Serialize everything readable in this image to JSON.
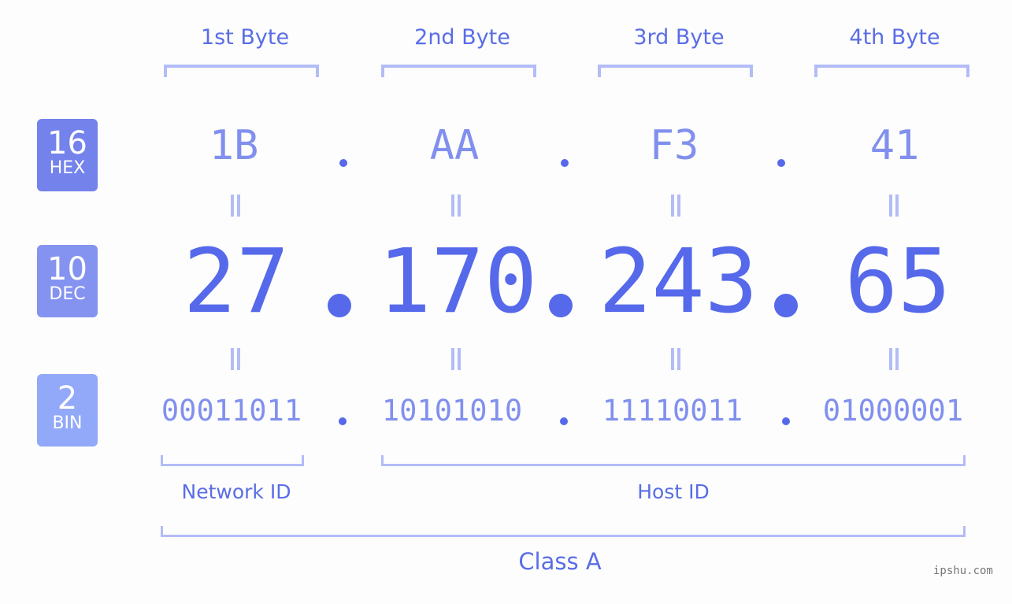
{
  "bytes": [
    {
      "label": "1st Byte",
      "hex": "1B",
      "dec": "27",
      "bin": "00011011"
    },
    {
      "label": "2nd Byte",
      "hex": "AA",
      "dec": "170",
      "bin": "10101010"
    },
    {
      "label": "3rd Byte",
      "hex": "F3",
      "dec": "243",
      "bin": "11110011"
    },
    {
      "label": "4th Byte",
      "hex": "41",
      "dec": "65",
      "bin": "01000001"
    }
  ],
  "badges": {
    "hex": {
      "number": "16",
      "label": "HEX",
      "color": "#7482eb"
    },
    "dec": {
      "number": "10",
      "label": "DEC",
      "color": "#8593f0"
    },
    "bin": {
      "number": "2",
      "label": "BIN",
      "color": "#91a9f8"
    }
  },
  "separator": ".",
  "groups": {
    "network_id": "Network ID",
    "host_id": "Host ID",
    "class": "Class A"
  },
  "watermark": "ipshu.com",
  "colors": {
    "primary": "#5669ea",
    "light": "#8190ee",
    "bracket": "#b3bcf7",
    "background": "#fcfdfc"
  }
}
